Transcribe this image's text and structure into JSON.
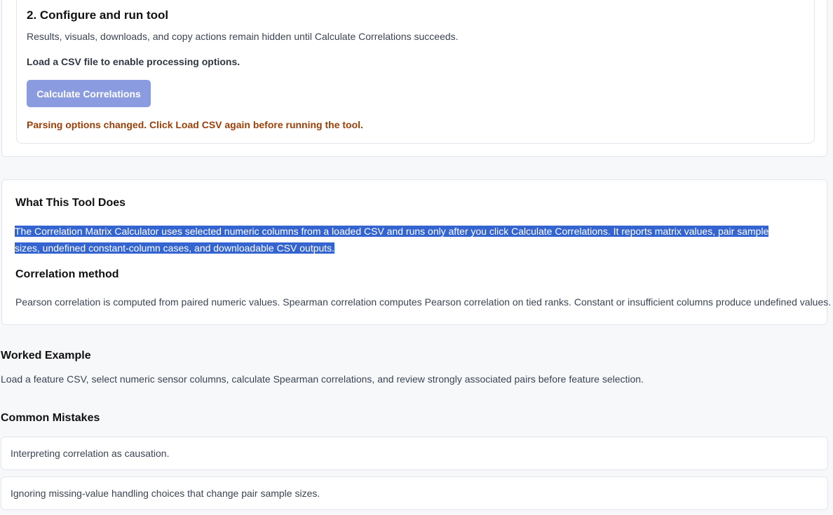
{
  "configure": {
    "title": "2. Configure and run tool",
    "description": "Results, visuals, downloads, and copy actions remain hidden until Calculate Correlations succeeds.",
    "load_note": "Load a CSV file to enable processing options.",
    "calculate_label": "Calculate Correlations",
    "calculate_disabled": true,
    "warning": "Parsing options changed. Click Load CSV again before running the tool.",
    "colors": {
      "button_disabled": "#8a9be0",
      "warning": "#9a3f07"
    }
  },
  "about": {
    "title": "What This Tool Does",
    "text": "The Correlation Matrix Calculator uses selected numeric columns from a loaded CSV and runs only after you click Calculate Correlations. It reports matrix values, pair sample sizes, undefined constant-column cases, and downloadable CSV outputs.",
    "text_selected": true,
    "method_title": "Correlation method",
    "method_text": "Pearson correlation is computed from paired numeric values. Spearman correlation computes Pearson correlation on tied ranks. Constant or insufficient columns produce undefined values.",
    "colors": {
      "selection": "#3464cf"
    }
  },
  "example": {
    "title": "Worked Example",
    "text": "Load a feature CSV, select numeric sensor columns, calculate Spearman correlations, and review strongly associated pairs before feature selection."
  },
  "mistakes": {
    "title": "Common Mistakes",
    "items": [
      "Interpreting correlation as causation.",
      "Ignoring missing-value handling choices that change pair sample sizes."
    ]
  }
}
